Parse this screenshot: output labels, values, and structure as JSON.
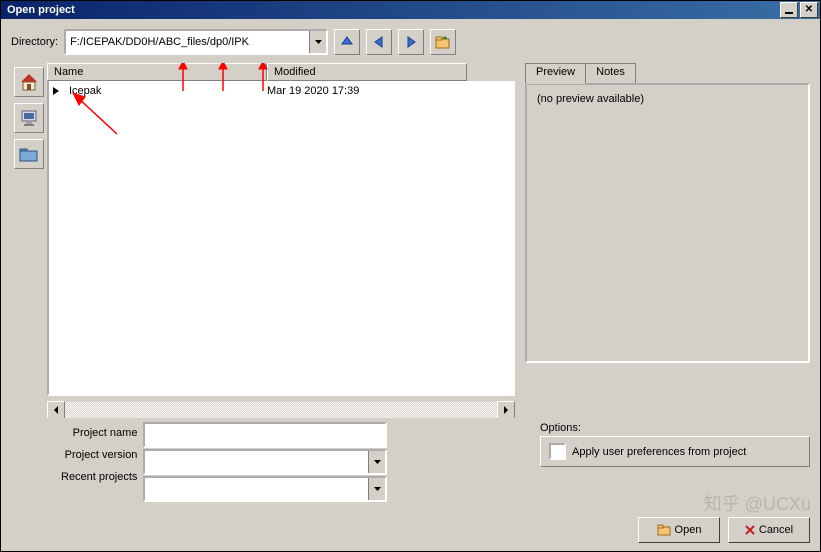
{
  "window": {
    "title": "Open project"
  },
  "directory": {
    "label": "Directory:",
    "value": "F:/ICEPAK/DD0H/ABC_files/dp0/IPK"
  },
  "nav": {
    "up": "up-icon",
    "back": "back-icon",
    "forward": "forward-icon",
    "folder": "open-folder-icon"
  },
  "sidebar": {
    "home": "home-icon",
    "computer": "computer-icon",
    "folder": "folder-icon"
  },
  "filelist": {
    "columns": {
      "name": "Name",
      "modified": "Modified"
    },
    "rows": [
      {
        "name": "Icepak",
        "modified": "Mar 19 2020 17:39"
      }
    ]
  },
  "preview": {
    "tabs": {
      "preview": "Preview",
      "notes": "Notes"
    },
    "empty": "(no preview available)"
  },
  "form": {
    "project_name_label": "Project name",
    "project_name_value": "",
    "project_version_label": "Project version",
    "project_version_value": "",
    "recent_projects_label": "Recent projects",
    "recent_projects_value": ""
  },
  "options": {
    "label": "Options:",
    "apply_prefs": "Apply user preferences from project"
  },
  "buttons": {
    "open": "Open",
    "cancel": "Cancel"
  },
  "watermark": "知乎 @UCXu"
}
